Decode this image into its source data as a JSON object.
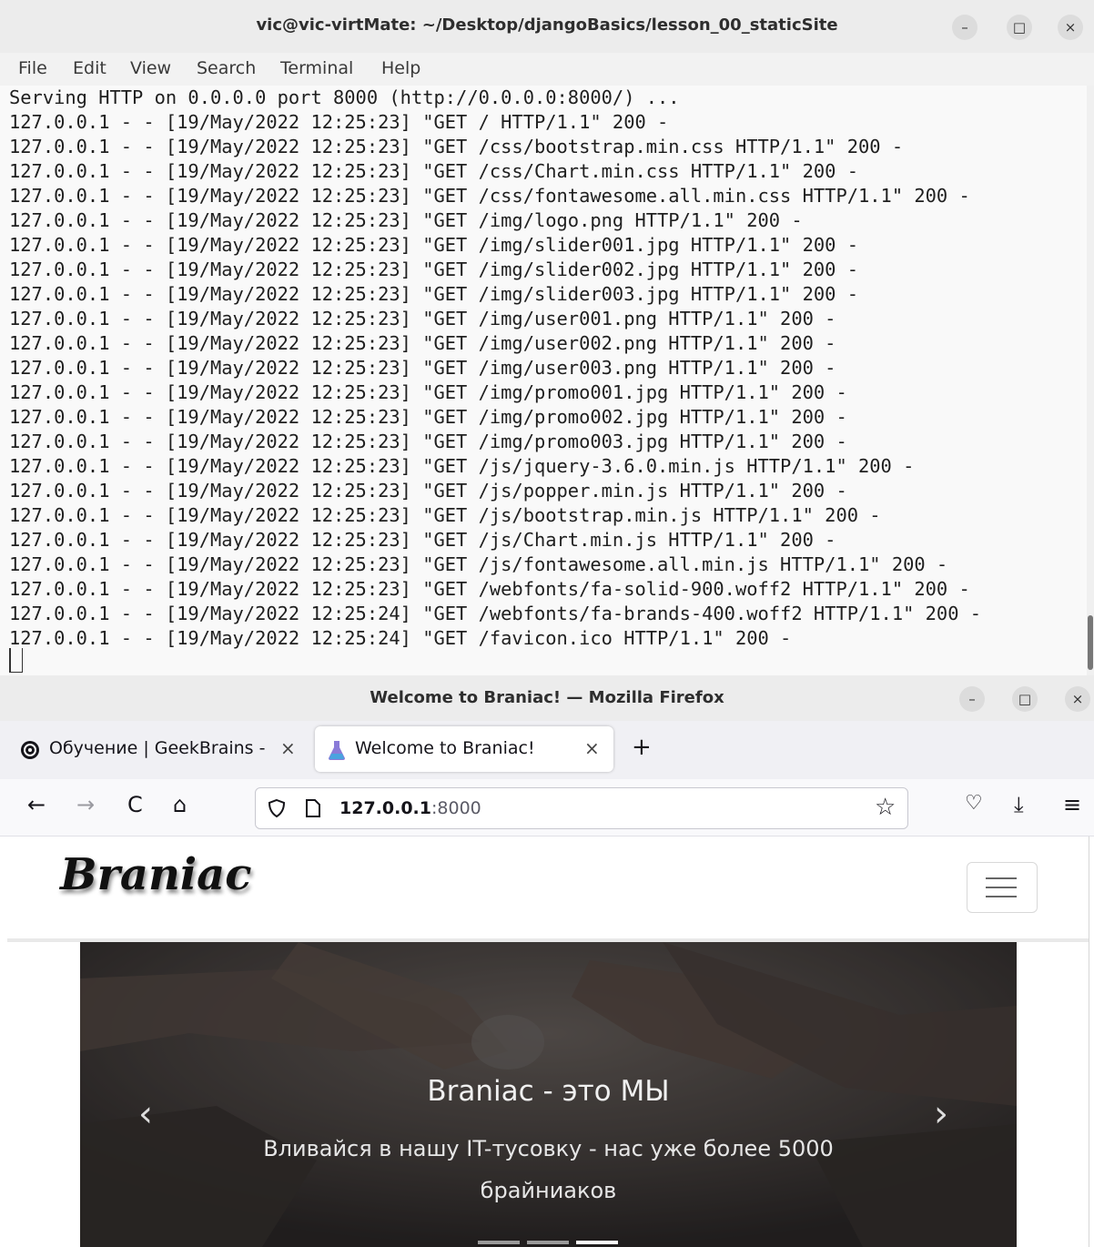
{
  "terminal": {
    "title": "vic@vic-virtMate: ~/Desktop/djangoBasics/lesson_00_staticSite",
    "window_buttons": {
      "minimize": "–",
      "maximize": "□",
      "close": "×"
    },
    "menu": [
      "File",
      "Edit",
      "View",
      "Search",
      "Terminal",
      "Help"
    ],
    "lines": [
      "Serving HTTP on 0.0.0.0 port 8000 (http://0.0.0.0:8000/) ...",
      "127.0.0.1 - - [19/May/2022 12:25:23] \"GET / HTTP/1.1\" 200 -",
      "127.0.0.1 - - [19/May/2022 12:25:23] \"GET /css/bootstrap.min.css HTTP/1.1\" 200 -",
      "127.0.0.1 - - [19/May/2022 12:25:23] \"GET /css/Chart.min.css HTTP/1.1\" 200 -",
      "127.0.0.1 - - [19/May/2022 12:25:23] \"GET /css/fontawesome.all.min.css HTTP/1.1\" 200 -",
      "127.0.0.1 - - [19/May/2022 12:25:23] \"GET /img/logo.png HTTP/1.1\" 200 -",
      "127.0.0.1 - - [19/May/2022 12:25:23] \"GET /img/slider001.jpg HTTP/1.1\" 200 -",
      "127.0.0.1 - - [19/May/2022 12:25:23] \"GET /img/slider002.jpg HTTP/1.1\" 200 -",
      "127.0.0.1 - - [19/May/2022 12:25:23] \"GET /img/slider003.jpg HTTP/1.1\" 200 -",
      "127.0.0.1 - - [19/May/2022 12:25:23] \"GET /img/user001.png HTTP/1.1\" 200 -",
      "127.0.0.1 - - [19/May/2022 12:25:23] \"GET /img/user002.png HTTP/1.1\" 200 -",
      "127.0.0.1 - - [19/May/2022 12:25:23] \"GET /img/user003.png HTTP/1.1\" 200 -",
      "127.0.0.1 - - [19/May/2022 12:25:23] \"GET /img/promo001.jpg HTTP/1.1\" 200 -",
      "127.0.0.1 - - [19/May/2022 12:25:23] \"GET /img/promo002.jpg HTTP/1.1\" 200 -",
      "127.0.0.1 - - [19/May/2022 12:25:23] \"GET /img/promo003.jpg HTTP/1.1\" 200 -",
      "127.0.0.1 - - [19/May/2022 12:25:23] \"GET /js/jquery-3.6.0.min.js HTTP/1.1\" 200 -",
      "127.0.0.1 - - [19/May/2022 12:25:23] \"GET /js/popper.min.js HTTP/1.1\" 200 -",
      "127.0.0.1 - - [19/May/2022 12:25:23] \"GET /js/bootstrap.min.js HTTP/1.1\" 200 -",
      "127.0.0.1 - - [19/May/2022 12:25:23] \"GET /js/Chart.min.js HTTP/1.1\" 200 -",
      "127.0.0.1 - - [19/May/2022 12:25:23] \"GET /js/fontawesome.all.min.js HTTP/1.1\" 200 -",
      "127.0.0.1 - - [19/May/2022 12:25:23] \"GET /webfonts/fa-solid-900.woff2 HTTP/1.1\" 200 -",
      "127.0.0.1 - - [19/May/2022 12:25:24] \"GET /webfonts/fa-brands-400.woff2 HTTP/1.1\" 200 -",
      "127.0.0.1 - - [19/May/2022 12:25:24] \"GET /favicon.ico HTTP/1.1\" 200 -"
    ]
  },
  "firefox": {
    "title": "Welcome to Braniac! — Mozilla Firefox",
    "window_buttons": {
      "minimize": "–",
      "maximize": "□",
      "close": "×"
    },
    "tabs": [
      {
        "label": "Обучение | GeekBrains -",
        "close": "×",
        "active": false
      },
      {
        "label": "Welcome to Braniac!",
        "close": "×",
        "active": true
      }
    ],
    "new_tab": "+",
    "nav": {
      "back": "←",
      "forward": "→",
      "reload": "C",
      "home": "⌂"
    },
    "url_host": "127.0.0.1",
    "url_port": ":8000",
    "toolbar": {
      "bookmark": "☆",
      "pocket": "♡",
      "download": "⤓",
      "menu": "≡"
    },
    "page": {
      "brand": "Braniac",
      "carousel": {
        "title": "Braniac - это МЫ",
        "subtitle": "Вливайся в нашу IT-тусовку - нас уже более 5000 брайниаков",
        "prev": "‹",
        "next": "›",
        "indicators": 3,
        "active_indicator": 3
      }
    },
    "colors": {
      "accent": "#15141a",
      "caption": "#f0f0f0"
    }
  }
}
